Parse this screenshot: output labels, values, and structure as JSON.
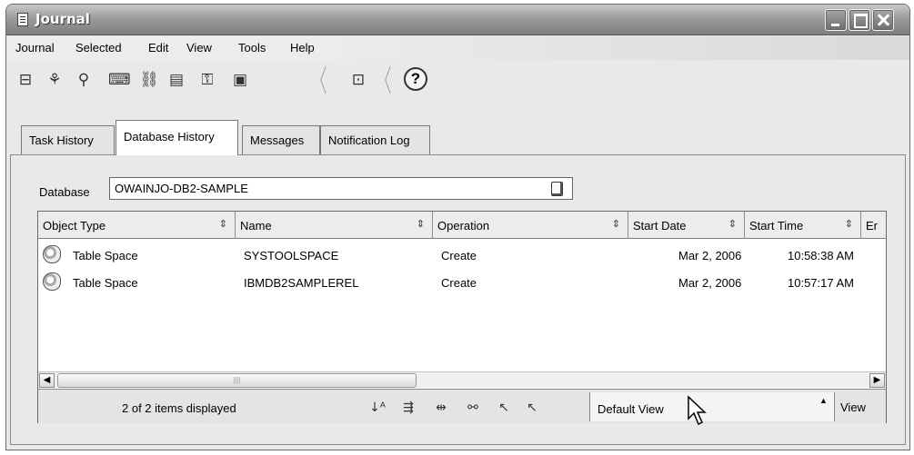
{
  "window": {
    "title": "Journal"
  },
  "menu": [
    "Journal",
    "Selected",
    "Edit",
    "View",
    "Tools",
    "Help"
  ],
  "toolbar_icons": [
    "task-center-icon",
    "replication-center-icon",
    "journal-icon",
    "command-editor-icon",
    "development-center-icon",
    "health-center-icon",
    "license-center-icon",
    "configuration-assistant-icon",
    "tools-settings-icon",
    "help-icon"
  ],
  "help_glyph": "?",
  "tabs": [
    {
      "label": "Task History",
      "active": false
    },
    {
      "label": "Database History",
      "active": true
    },
    {
      "label": "Messages",
      "active": false
    },
    {
      "label": "Notification Log",
      "active": false
    }
  ],
  "database": {
    "label": "Database",
    "value": "OWAINJO-DB2-SAMPLE"
  },
  "table": {
    "columns": [
      "Object Type",
      "Name",
      "Operation",
      "Start Date",
      "Start Time",
      "Er"
    ],
    "sort_glyph": "⇕",
    "rows": [
      {
        "object_type": "Table Space",
        "name": "SYSTOOLSPACE",
        "operation": "Create",
        "start_date": "Mar 2, 2006",
        "start_time": "10:58:38 AM"
      },
      {
        "object_type": "Table Space",
        "name": "IBMDB2SAMPLEREL",
        "operation": "Create",
        "start_date": "Mar 2, 2006",
        "start_time": "10:57:17 AM"
      }
    ]
  },
  "status": {
    "count_text": "2 of 2 items displayed",
    "view_value": "Default View",
    "view_button": "View"
  },
  "colors": {
    "titlebar": "#8a8a8a",
    "background": "#e9e9e9"
  }
}
